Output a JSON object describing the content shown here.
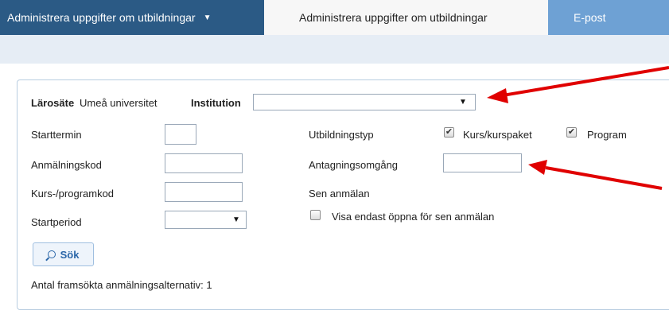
{
  "nav": {
    "menu_label": "Administrera uppgifter om utbildningar",
    "menu_caret": "▼",
    "active_tab": "Administrera uppgifter om utbildningar",
    "email_tab": "E-post"
  },
  "form": {
    "larosate_label": "Lärosäte",
    "larosate_value": "Umeå universitet",
    "institution_label": "Institution",
    "institution_value": "",
    "starttermin_label": "Starttermin",
    "starttermin_value": "",
    "anmalningskod_label": "Anmälningskod",
    "anmalningskod_value": "",
    "kurskod_label": "Kurs-/programkod",
    "kurskod_value": "",
    "startperiod_label": "Startperiod",
    "startperiod_value": "",
    "utbildningstyp_label": "Utbildningstyp",
    "kurs_label": "Kurs/kurspaket",
    "kurs_checked": true,
    "program_label": "Program",
    "program_checked": true,
    "antagning_label": "Antagningsomgång",
    "antagning_value": "",
    "sen_label": "Sen anmälan",
    "sen_checkbox_label": "Visa endast öppna för sen anmälan",
    "sen_checked": false,
    "search_button": "Sök",
    "result_text": "Antal framsökta anmälningsalternativ: 1"
  },
  "colors": {
    "nav_dark": "#2b5a85",
    "nav_light": "#6ea1d4",
    "annotation_arrow": "#e00000"
  },
  "icons": {
    "select_arrow": "▼",
    "check": "✔",
    "search": "search-icon"
  }
}
